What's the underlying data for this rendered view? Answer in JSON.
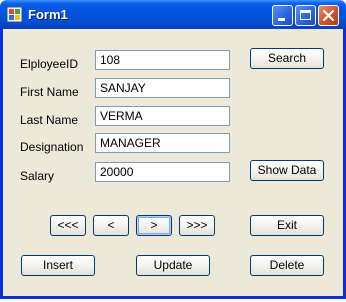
{
  "window": {
    "title": "Form1"
  },
  "fields": [
    {
      "label": "ElployeeID",
      "value": "108"
    },
    {
      "label": "First Name",
      "value": "SANJAY"
    },
    {
      "label": "Last Name",
      "value": "VERMA"
    },
    {
      "label": "Designation",
      "value": "MANAGER"
    },
    {
      "label": "Salary",
      "value": "20000"
    }
  ],
  "buttons": {
    "search": "Search",
    "show_data": "Show Data",
    "first": "<<<",
    "prev": "<",
    "next": ">",
    "last": ">>>",
    "exit": "Exit",
    "insert": "Insert",
    "update": "Update",
    "delete": "Delete"
  },
  "colors": {
    "titlebar": "#0454e2",
    "frame": "#0831d9",
    "client": "#ece9d8",
    "close_button": "#d4502c"
  }
}
